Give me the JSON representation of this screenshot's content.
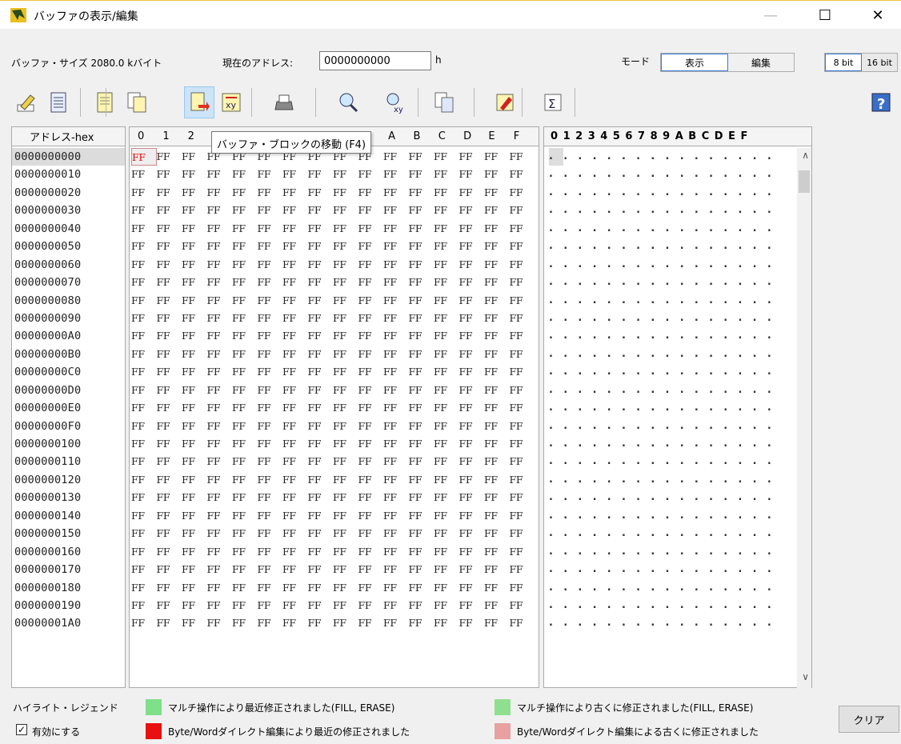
{
  "window": {
    "title": "バッファの表示/編集",
    "min": "—",
    "max": "☐",
    "close": "✕"
  },
  "info": {
    "size_label": "バッファ・サイズ 2080.0 kバイト",
    "addr_label": "現在のアドレス:",
    "addr_value": "0000000000",
    "addr_suffix": "h",
    "mode_label": "モード"
  },
  "mode": {
    "view": "表示",
    "edit": "編集"
  },
  "bits": {
    "b8": "8 bit",
    "b16": "16 bit"
  },
  "toolbar": {
    "tooltip": "バッファ・ブロックの移動 (F4)",
    "help": "?",
    "sigma": "Σ",
    "icons": [
      "edit-icon",
      "document-icon",
      "open-buffer-icon",
      "copy-icon",
      "move-block-icon",
      "swap-xy-icon",
      "print-icon",
      "search-icon",
      "search-xy-icon",
      "compare-icon",
      "marker-icon",
      "checksum-icon",
      "help-icon"
    ]
  },
  "grid": {
    "addr_header": "アドレス-hex",
    "hex_headers": [
      "0",
      "1",
      "2",
      "3",
      "4",
      "5",
      "6",
      "7",
      "8",
      "9",
      "A",
      "B",
      "C",
      "D",
      "E",
      "F"
    ],
    "ascii_header": "0 1 2 3 4 5 6 7 8 9 A B C D E F",
    "addresses": [
      "0000000000",
      "0000000010",
      "0000000020",
      "0000000030",
      "0000000040",
      "0000000050",
      "0000000060",
      "0000000070",
      "0000000080",
      "0000000090",
      "00000000A0",
      "00000000B0",
      "00000000C0",
      "00000000D0",
      "00000000E0",
      "00000000F0",
      "0000000100",
      "0000000110",
      "0000000120",
      "0000000130",
      "0000000140",
      "0000000150",
      "0000000160",
      "0000000170",
      "0000000180",
      "0000000190",
      "00000001A0"
    ],
    "byte_value": "FF",
    "ascii_char": "."
  },
  "legend": {
    "title": "ハイライト・レジェンド",
    "enable_label": "有効にする",
    "enabled": true,
    "item1": "マルチ操作により最近修正されました(FILL, ERASE)",
    "item2": "マルチ操作により古くに修正されました(FILL, ERASE)",
    "item3": "Byte/Wordダイレクト編集により最近の修正されました",
    "item4": "Byte/Wordダイレクト編集による古くに修正されました",
    "colors": [
      "#7ee08a",
      "#8ee08e",
      "#e81010",
      "#e8a0a0"
    ],
    "clear": "クリア"
  }
}
